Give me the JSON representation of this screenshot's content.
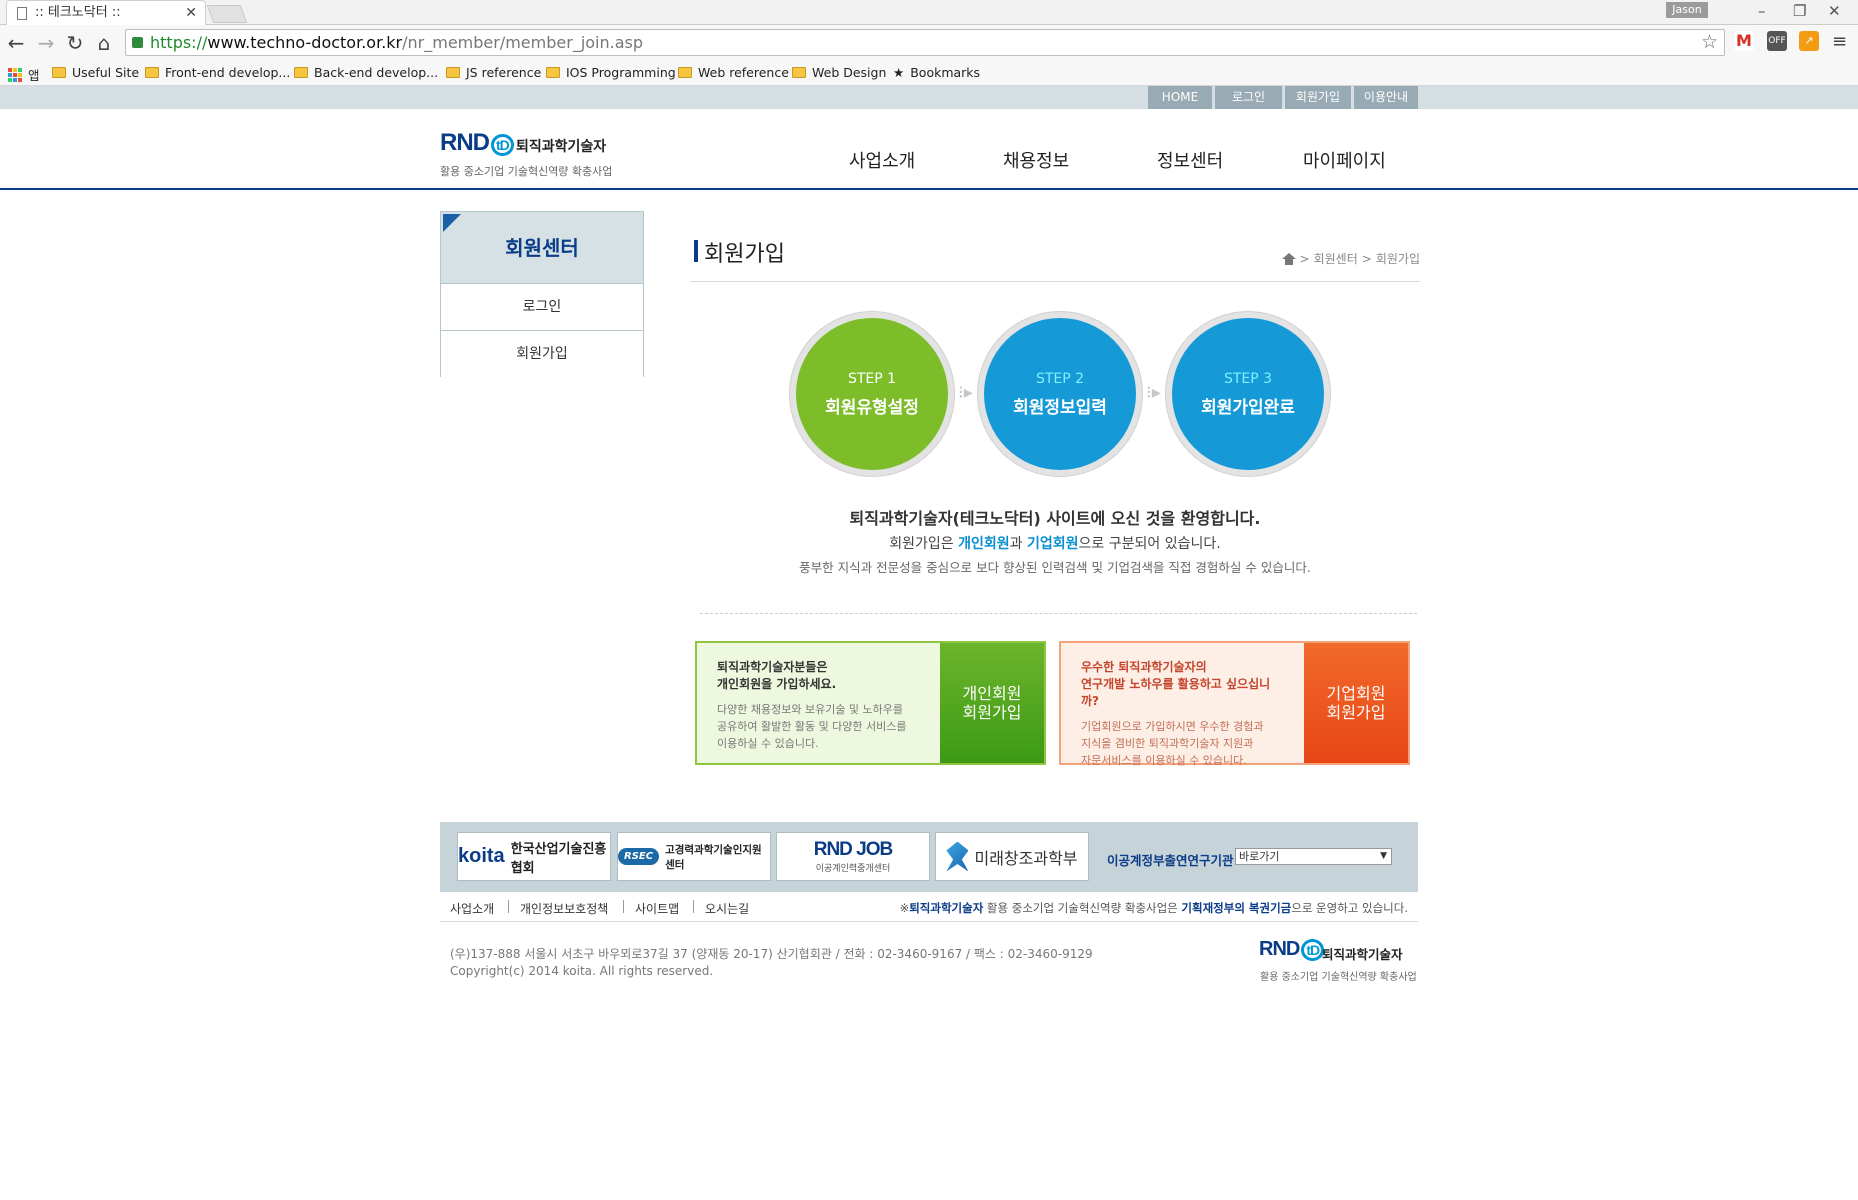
{
  "browser": {
    "tab_title": ":: 테크노닥터 ::",
    "profile_name": "Jason",
    "url_scheme": "https://",
    "url_host": "www.techno-doctor.or.kr",
    "url_path": "/nr_member/member_join.asp",
    "bookmarks": [
      "앱",
      "Useful Site",
      "Front-end develop...",
      "Back-end develop...",
      "JS reference",
      "IOS Programming",
      "Web reference",
      "Web Design",
      "Bookmarks"
    ],
    "extensions": {
      "gmail": "M",
      "off": "OFF"
    }
  },
  "util_nav": [
    "HOME",
    "로그인",
    "회원가입",
    "이용안내"
  ],
  "logo": {
    "mark": "RND",
    "mark_td": "tD",
    "name": "퇴직과학기술자",
    "sub": "활용 중소기업 기술혁신역량 확충사업"
  },
  "gnb": [
    "사업소개",
    "채용정보",
    "정보센터",
    "마이페이지"
  ],
  "lnb": {
    "title": "회원센터",
    "items": [
      "로그인",
      "회원가입"
    ]
  },
  "page": {
    "title": "회원가입",
    "breadcrumb": [
      "회원센터",
      "회원가입"
    ],
    "breadcrumb_sep": ">"
  },
  "steps": [
    {
      "num": "STEP 1",
      "label": "회원유형설정"
    },
    {
      "num": "STEP 2",
      "label": "회원정보입력"
    },
    {
      "num": "STEP 3",
      "label": "회원가입완료"
    }
  ],
  "welcome": {
    "line1": "퇴직과학기술자(테크노닥터) 사이트에 오신 것을 환영합니다.",
    "line2_pre": "회원가입은 ",
    "line2_personal": "개인회원",
    "line2_mid": "과 ",
    "line2_company": "기업회원",
    "line2_post": "으로 구분되어 있습니다.",
    "line3": "풍부한 지식과 전문성을 중심으로 보다 향상된 인력검색 및 기업검색을 직접 경험하실 수 있습니다."
  },
  "join_personal": {
    "head1": "퇴직과학기술자분들은",
    "head2": "개인회원을 가입하세요.",
    "body1": "다양한 채용정보와 보유기술 및 노하우를",
    "body2": "공유하여 활발한 활동 및 다양한 서비스를",
    "body3": "이용하실 수 있습니다.",
    "btn1": "개인회원",
    "btn2": "회원가입"
  },
  "join_company": {
    "head1": "우수한 퇴직과학기술자의",
    "head2": "연구개발 노하우를 활용하고 싶으십니까?",
    "body1": "기업회원으로 가입하시면 우수한 경험과",
    "body2": "지식을 겸비한 퇴직과학기술자 지원과",
    "body3": "자문서비스를 이용하실 수 있습니다.",
    "btn1": "기업회원",
    "btn2": "회원가입"
  },
  "partners": {
    "koita_mark": "koita",
    "koita_name": "한국산업기술진흥협회",
    "rsec_mark": "RSEC",
    "rsec_name": "고경력과학기술인지원센터",
    "rndjob_mark": "RND JOB",
    "rndjob_sub": "이공계인력중개센터",
    "msip_name": "미래창조과학부"
  },
  "related": {
    "label": "이공계정부출연연구기관",
    "select_value": "바로가기"
  },
  "footer": {
    "links": [
      "사업소개",
      "개인정보보호정책",
      "사이트맵",
      "오시는길"
    ],
    "note_pre": "※",
    "note_org": "퇴직과학기술자",
    "note_mid": " 활용 중소기업 기술혁신역량 확충사업은 ",
    "note_fund": "기획재정부의 복권기금",
    "note_post": "으로 운영하고 있습니다.",
    "address": "(우)137-888 서울시 서초구 바우뫼로37길 37 (양재동 20-17) 산기협회관 / 전화 : 02-3460-9167 / 팩스 : 02-3460-9129",
    "copyright": "Copyright(c) 2014 koita. All rights reserved."
  },
  "colors": {
    "brand_navy": "#0b3c88",
    "step_green": "#7dbd2a",
    "step_blue": "#1599d7",
    "personal_green": "#3d9a14",
    "company_orange": "#e74616"
  }
}
